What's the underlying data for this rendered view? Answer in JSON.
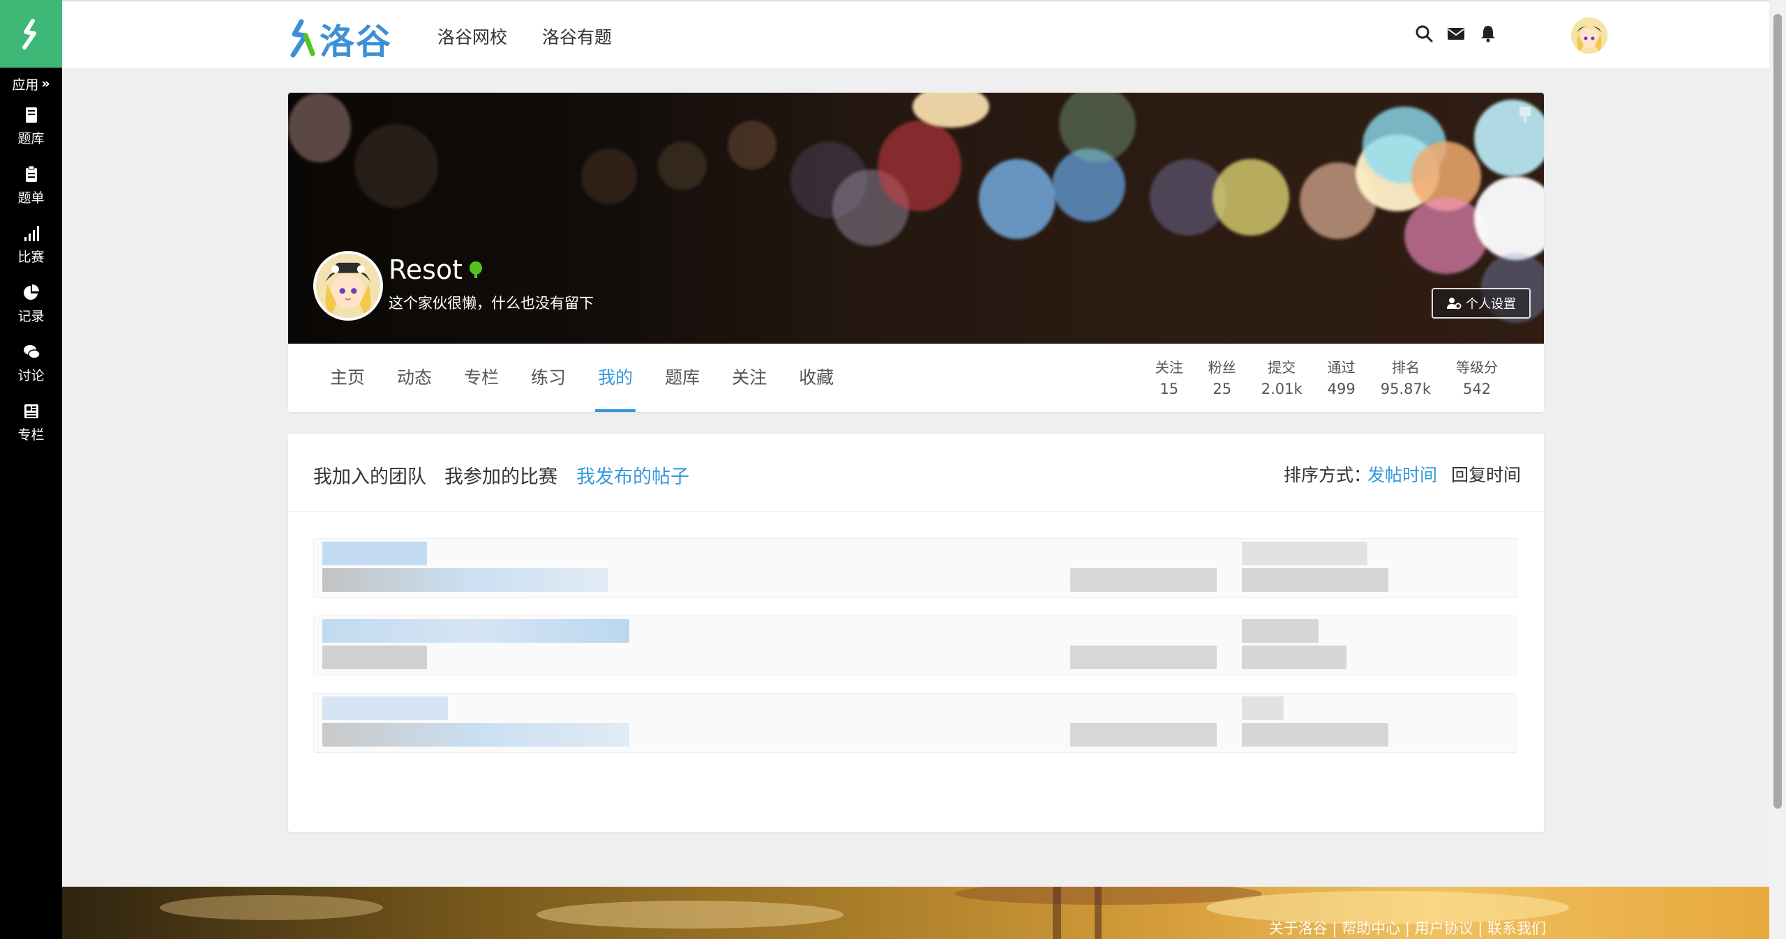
{
  "sidebar": {
    "apps_label": "应用",
    "items": [
      {
        "label": "题库",
        "icon": "book-icon"
      },
      {
        "label": "题单",
        "icon": "clipboard-icon"
      },
      {
        "label": "比赛",
        "icon": "bar-chart-icon"
      },
      {
        "label": "记录",
        "icon": "pie-chart-icon"
      },
      {
        "label": "讨论",
        "icon": "comments-icon"
      },
      {
        "label": "专栏",
        "icon": "newspaper-icon"
      }
    ]
  },
  "header": {
    "logo_text": "洛谷",
    "nav": [
      "洛谷网校",
      "洛谷有题"
    ],
    "icons": [
      "search-icon",
      "mail-icon",
      "bell-icon"
    ]
  },
  "profile": {
    "username": "Resot",
    "signature": "这个家伙很懒，什么也没有留下",
    "settings_label": "个人设置",
    "tabs": [
      "主页",
      "动态",
      "专栏",
      "练习",
      "我的",
      "题库",
      "关注",
      "收藏"
    ],
    "active_tab": "我的",
    "stats": [
      {
        "label": "关注",
        "value": "15"
      },
      {
        "label": "粉丝",
        "value": "25"
      },
      {
        "label": "提交",
        "value": "2.01k"
      },
      {
        "label": "通过",
        "value": "499"
      },
      {
        "label": "排名",
        "value": "95.87k"
      },
      {
        "label": "等级分",
        "value": "542"
      }
    ]
  },
  "content": {
    "tabs": [
      "我加入的团队",
      "我参加的比赛",
      "我发布的帖子"
    ],
    "active_tab": "我发布的帖子",
    "sort_label": "排序方式：",
    "sort_options": [
      "发帖时间",
      "回复时间"
    ],
    "active_sort": "发帖时间"
  },
  "footer": {
    "links": "关于洛谷 | 帮助中心 | 用户协议 | 联系我们"
  },
  "colors": {
    "accent": "#3498db",
    "brand_green": "#3eb876",
    "sidebar_bg": "#000000",
    "name_badge": "#52c41a"
  }
}
